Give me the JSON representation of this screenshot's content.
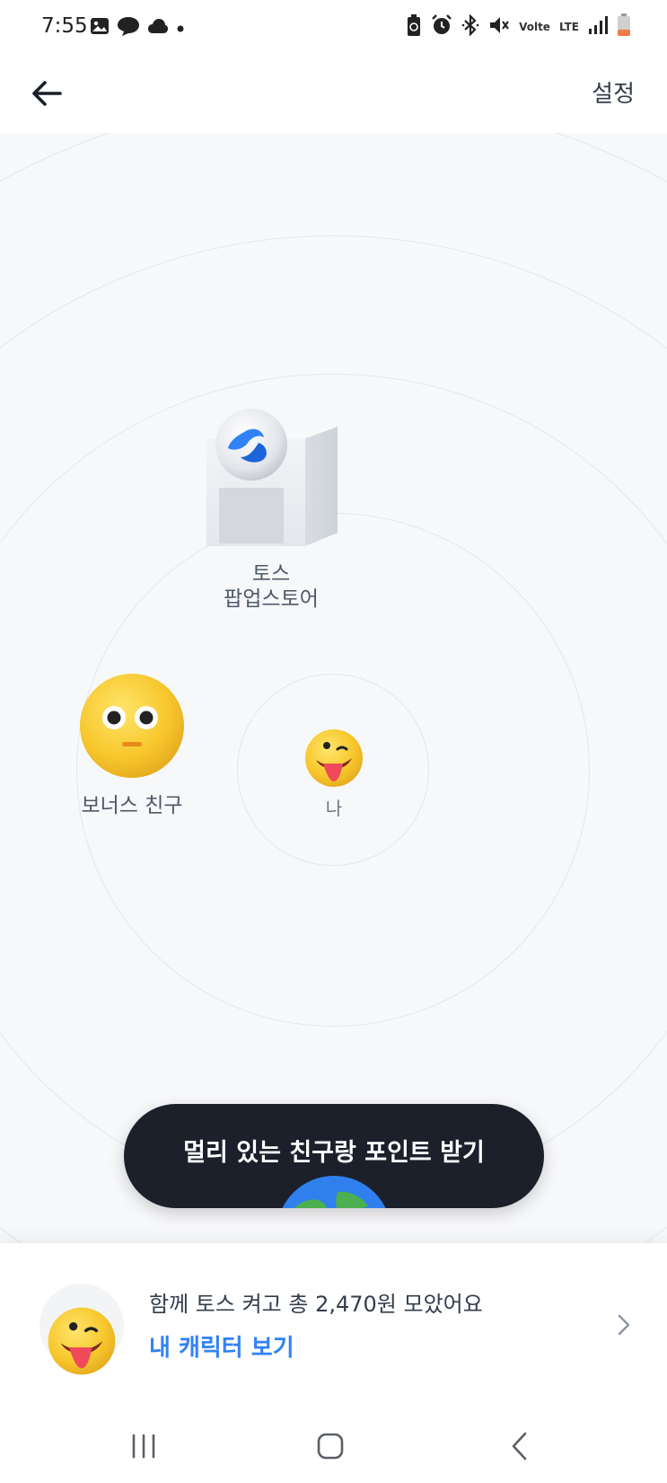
{
  "status_bar": {
    "time": "7:55",
    "left_icons": [
      "gallery-icon",
      "chat-bubble-icon",
      "cloud-icon",
      "dot-icon"
    ],
    "right_icons": [
      "battery-saver-icon",
      "alarm-icon",
      "bluetooth-icon",
      "mute-icon",
      "volte-icon",
      "lte-icon",
      "signal-icon",
      "battery-icon"
    ],
    "volte_text": "Volte",
    "lte_text": "LTE"
  },
  "header": {
    "settings_label": "설정"
  },
  "radar": {
    "store": {
      "line1": "토스",
      "line2": "팝업스토어"
    },
    "bonus_friend": {
      "label": "보너스 친구"
    },
    "me": {
      "label": "나"
    }
  },
  "cta": {
    "label": "멀리 있는 친구랑 포인트 받기"
  },
  "bottom_card": {
    "summary": "함께 토스 켜고 총 2,470원 모았어요",
    "link_label": "내 캐릭터 보기"
  },
  "colors": {
    "accent": "#3182f6",
    "cta_bg": "#1b202b",
    "background": "#f7f8fa",
    "emoji_yellow": "#f5c518"
  }
}
